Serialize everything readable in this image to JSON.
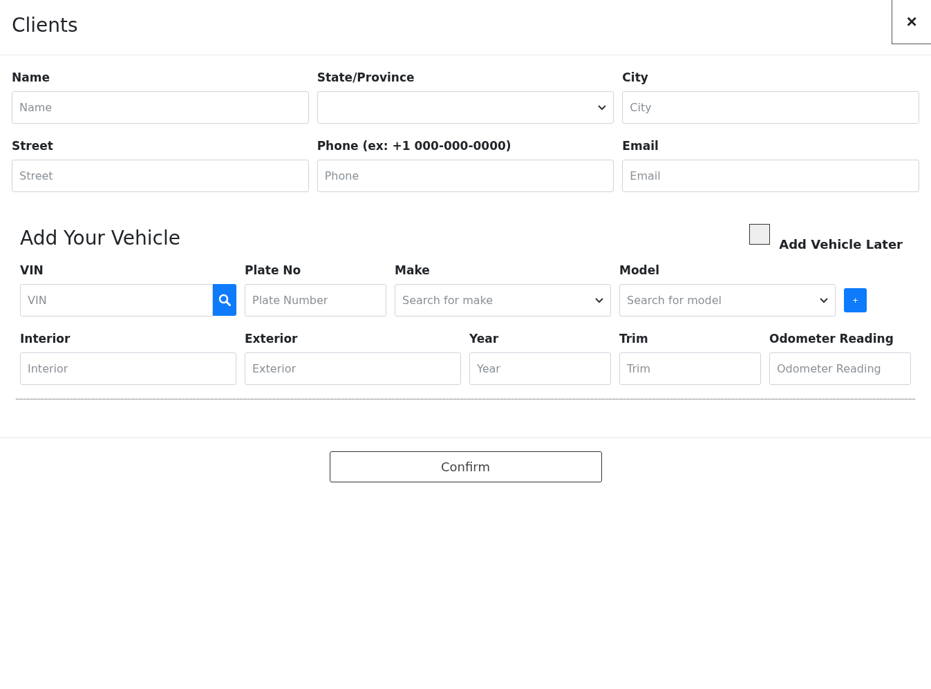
{
  "dialog": {
    "title": "Clients",
    "close": "×"
  },
  "client_fields": [
    {
      "label": "Name",
      "kind": "text",
      "placeholder": "Name"
    },
    {
      "label": "State/Province",
      "kind": "select"
    },
    {
      "label": "City",
      "kind": "text",
      "placeholder": "City"
    },
    {
      "label": "Street",
      "kind": "text",
      "placeholder": "Street"
    },
    {
      "label": "Phone (ex: +1 000-000-0000)",
      "kind": "text",
      "placeholder": "Phone"
    },
    {
      "label": "Email",
      "kind": "text",
      "placeholder": "Email"
    }
  ],
  "vehicle": {
    "title": "Add Your Vehicle",
    "add_later": {
      "label": "Add Vehicle Later",
      "checked": false
    },
    "row_1": [
      {
        "label": "VIN",
        "kind": "search",
        "placeholder": "VIN"
      },
      {
        "label": "Plate No",
        "kind": "text",
        "placeholder": "Plate Number"
      },
      {
        "label": "Make",
        "kind": "select",
        "placeholder": "Search for make"
      },
      {
        "label": "Model",
        "kind": "select",
        "placeholder": "Search for model"
      },
      {
        "kind": "add",
        "text": "+"
      }
    ],
    "row_2": [
      {
        "label": "Interior",
        "kind": "text",
        "placeholder": "Interior"
      },
      {
        "label": "Exterior",
        "kind": "text",
        "placeholder": "Exterior"
      },
      {
        "label": "Year",
        "kind": "text",
        "placeholder": "Year"
      },
      {
        "label": "Trim",
        "kind": "text",
        "placeholder": "Trim"
      },
      {
        "label": "Odometer Reading",
        "kind": "text",
        "placeholder": "Odometer Reading"
      }
    ]
  },
  "footer": {
    "confirm": "Confirm"
  }
}
